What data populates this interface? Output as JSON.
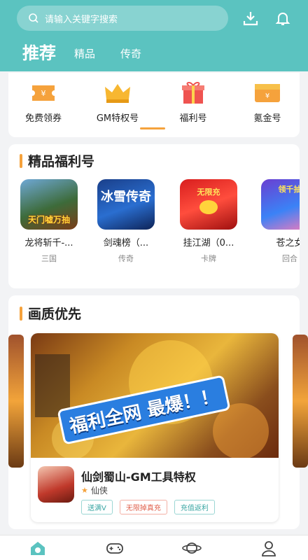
{
  "header": {
    "search_placeholder": "请输入关键字搜索",
    "tabs": [
      {
        "label": "推荐",
        "active": true
      },
      {
        "label": "精品",
        "active": false
      },
      {
        "label": "传奇",
        "active": false
      }
    ],
    "icons": [
      "download-icon",
      "bell-icon"
    ]
  },
  "categories": [
    {
      "label": "免费领券",
      "icon": "ticket-icon"
    },
    {
      "label": "GM特权号",
      "icon": "crown-icon",
      "active": true
    },
    {
      "label": "福利号",
      "icon": "gift-icon"
    },
    {
      "label": "氪金号",
      "icon": "gold-icon"
    }
  ],
  "section_welfare": {
    "title": "精品福利号",
    "games": [
      {
        "name": "龙将斩千-...",
        "genre": "三国",
        "thumb_text": "天门嘘万抽"
      },
      {
        "name": "剑魂榜（...",
        "genre": "传奇",
        "thumb_text": "冰雪传奇"
      },
      {
        "name": "挂江湖（0...",
        "genre": "卡牌",
        "thumb_text": "无限充"
      },
      {
        "name": "苍之女",
        "genre": "回合",
        "thumb_text": "领千抽"
      }
    ]
  },
  "section_quality": {
    "title": "画质优先",
    "banner": {
      "slogan": "福利全网 最爆！！",
      "title": "仙剑蜀山-GM工具特权",
      "genre": "仙侠",
      "tags": [
        {
          "label": "送满V",
          "color": "#3aa6a3"
        },
        {
          "label": "无限掉真充",
          "color": "#e0604c"
        },
        {
          "label": "充值返利",
          "color": "#3aa6a3"
        }
      ]
    }
  },
  "bottom_nav": [
    "home-icon",
    "gamepad-icon",
    "planet-icon",
    "user-icon"
  ],
  "colors": {
    "brand": "#5bc3c0",
    "accent": "#f5a23c"
  }
}
